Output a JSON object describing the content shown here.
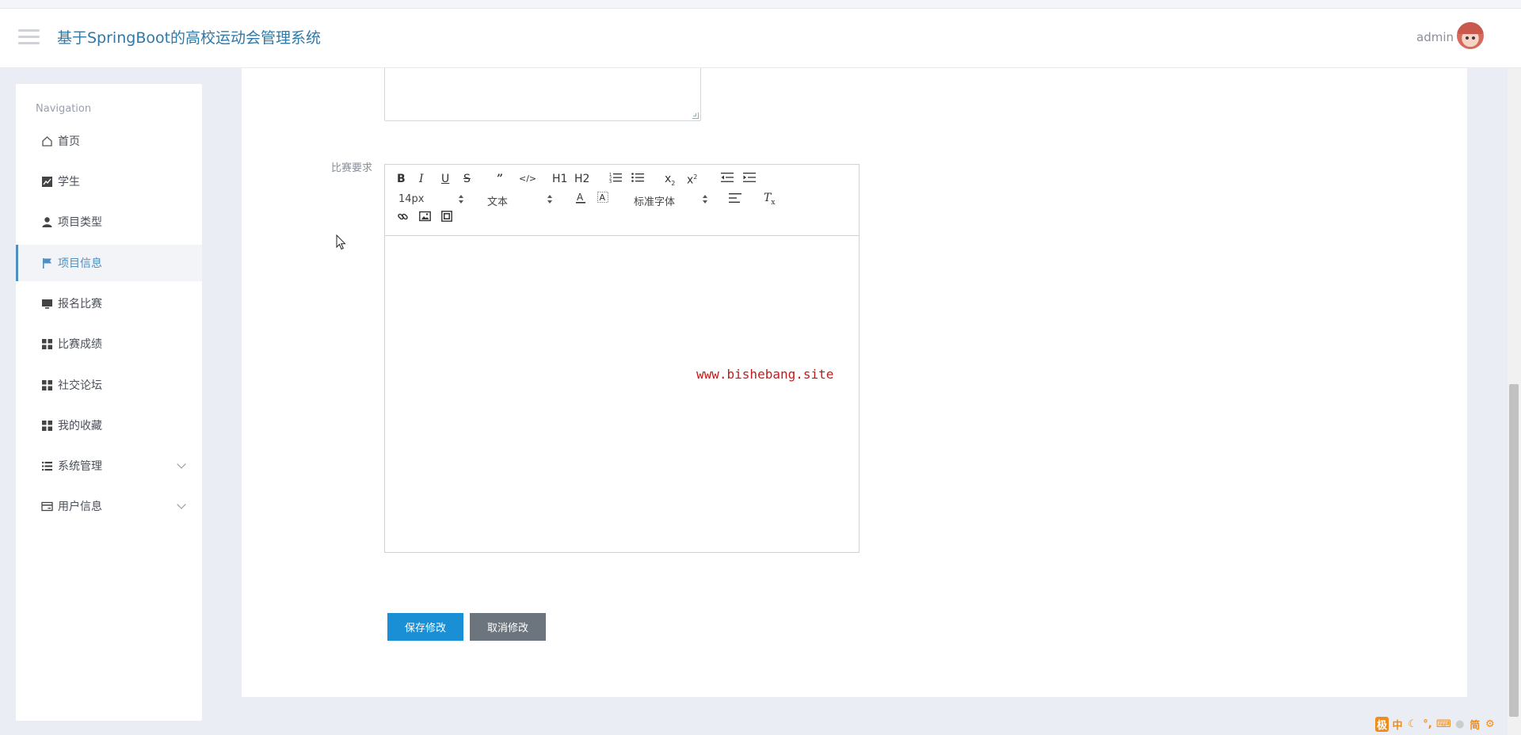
{
  "header": {
    "title": "基于SpringBoot的高校运动会管理系统",
    "user_name": "admin"
  },
  "sidebar": {
    "heading": "Navigation",
    "items": [
      {
        "label": "首页",
        "icon": "home-icon"
      },
      {
        "label": "学生",
        "icon": "line-chart-icon"
      },
      {
        "label": "项目类型",
        "icon": "user-icon"
      },
      {
        "label": "项目信息",
        "icon": "flag-icon",
        "active": true
      },
      {
        "label": "报名比赛",
        "icon": "monitor-icon"
      },
      {
        "label": "比赛成绩",
        "icon": "grid-icon"
      },
      {
        "label": "社交论坛",
        "icon": "grid-icon"
      },
      {
        "label": "我的收藏",
        "icon": "grid-icon"
      },
      {
        "label": "系统管理",
        "icon": "list-icon",
        "expandable": true
      },
      {
        "label": "用户信息",
        "icon": "card-icon",
        "expandable": true
      }
    ]
  },
  "form": {
    "requirement_label": "比赛要求",
    "editor": {
      "font_size": "14px",
      "text_style": "文本",
      "font_family": "标准字体",
      "h1": "H1",
      "h2": "H2",
      "content": ""
    },
    "watermark": "www.bishebang.site",
    "save_label": "保存修改",
    "cancel_label": "取消修改"
  },
  "taskbar": {
    "ime_items": [
      "极",
      "中",
      "简"
    ]
  },
  "colors": {
    "accent": "#2f79a6",
    "active_nav": "#4f8fc0",
    "save_button": "#1a8fd6",
    "cancel_button": "#6c757d",
    "watermark": "#c21b1b"
  }
}
